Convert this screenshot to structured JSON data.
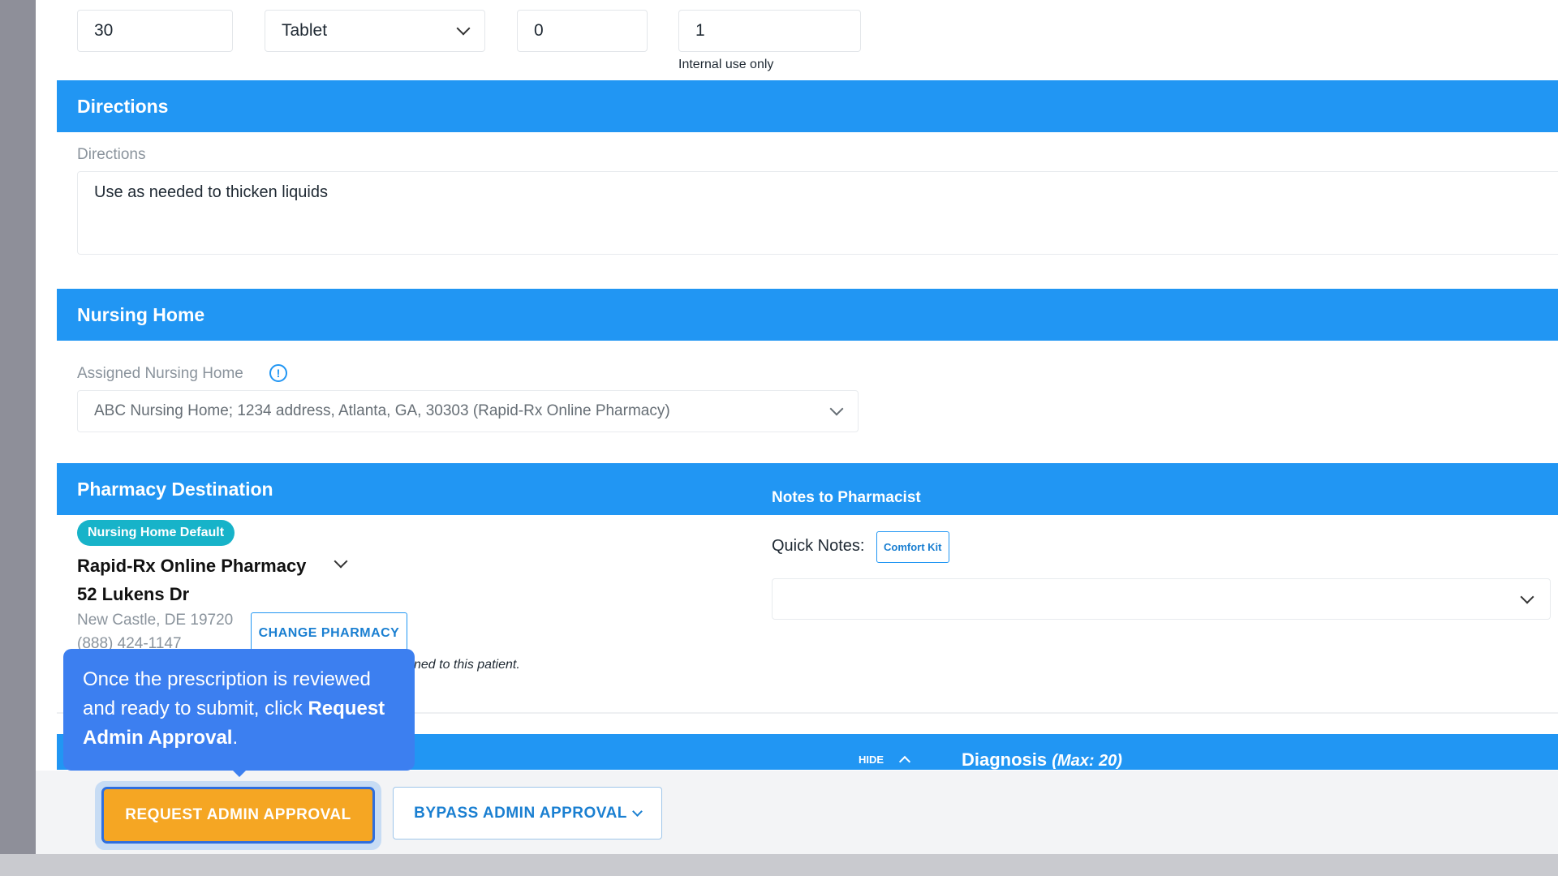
{
  "top_fields": {
    "quantity_value": "30",
    "form_value": "Tablet",
    "refills_value": "0",
    "days_supply_value": "1",
    "internal_note": "Internal use only"
  },
  "directions": {
    "section_title": "Directions",
    "field_label": "Directions",
    "value": "Use as needed to thicken liquids"
  },
  "nursing_home": {
    "section_title": "Nursing Home",
    "field_label": "Assigned Nursing Home",
    "selected": "ABC Nursing Home; 1234 address, Atlanta, GA, 30303 (Rapid-Rx Online Pharmacy)"
  },
  "pharmacy": {
    "section_title": "Pharmacy Destination",
    "badge": "Nursing Home Default",
    "name": "Rapid-Rx Online Pharmacy",
    "address": "52 Lukens Dr",
    "city": "New Castle, DE 19720",
    "phone": "(888) 424-1147",
    "change_label": "CHANGE PHARMACY",
    "assigned_note": "ned to this patient."
  },
  "notes": {
    "section_title": "Notes to Pharmacist",
    "quick_label": "Quick Notes:",
    "quick_chip": "Comfort Kit"
  },
  "diagnosis": {
    "hide_label": "HIDE",
    "title": "Diagnosis",
    "max": "(Max: 20)"
  },
  "footer": {
    "request_label": "REQUEST ADMIN APPROVAL",
    "bypass_label": "BYPASS ADMIN APPROVAL"
  },
  "tooltip": {
    "text_before": "Once the prescription is reviewed and ready to submit, click",
    "bold": "Request Admin Approval",
    "text_after": "."
  },
  "colors": {
    "primary": "#2196f3",
    "accent_orange": "#f5a623",
    "badge_teal": "#17b3c9",
    "tooltip_blue": "#3c7ff0"
  }
}
